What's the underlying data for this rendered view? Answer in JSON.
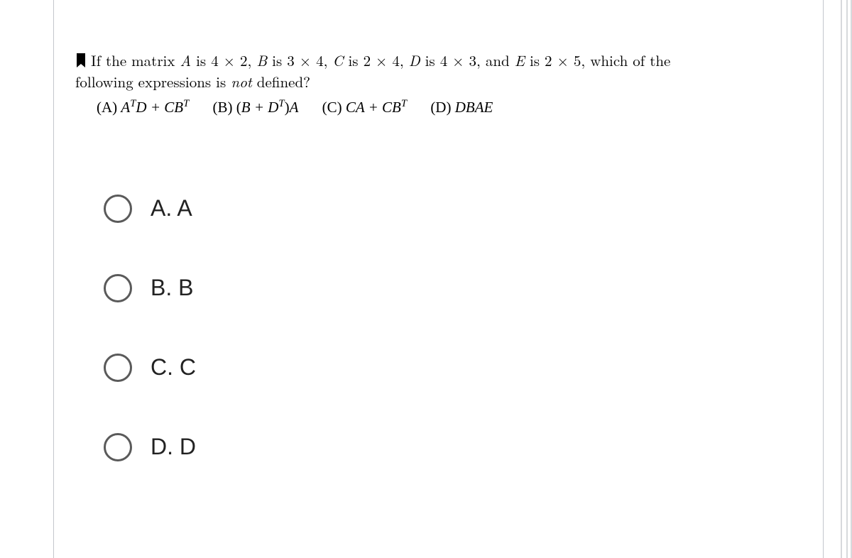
{
  "question": {
    "intro_pre": "If the matrix ",
    "A": "A",
    "A_dim": " is 4 × 2, ",
    "B": "B",
    "B_dim": " is 3 × 4, ",
    "C": "C",
    "C_dim": " is 2 × 4, ",
    "D": "D",
    "D_dim": " is 4 × 3, and ",
    "E": "E",
    "E_dim": " is 2 × 5, which of the",
    "line2_pre": "following expressions is ",
    "not": "not",
    "line2_post": " defined?"
  },
  "expressions": {
    "a_label": "(A) ",
    "a_body_1": "A",
    "a_sup": "T",
    "a_body_2": "D + CB",
    "a_sup2": "T",
    "b_label": "(B) ",
    "b_body_1": "(B + D",
    "b_sup": "T",
    "b_body_2": ")A",
    "c_label": "(C) ",
    "c_body_1": "CA + CB",
    "c_sup": "T",
    "d_label": "(D) ",
    "d_body": "DBAE"
  },
  "answers": [
    {
      "label": "A.  A"
    },
    {
      "label": "B.  B"
    },
    {
      "label": "C.  C"
    },
    {
      "label": "D.  D"
    }
  ]
}
